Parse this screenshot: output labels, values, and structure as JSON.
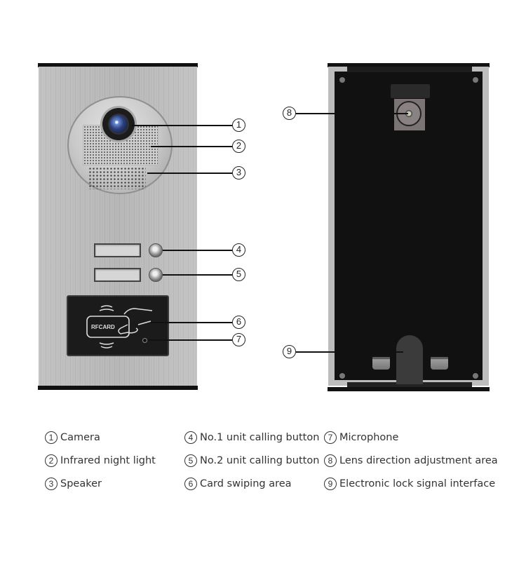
{
  "front_panel": {
    "card_reader_label": "RFCARD"
  },
  "callouts": [
    {
      "id": "1",
      "glyph": "1"
    },
    {
      "id": "2",
      "glyph": "2"
    },
    {
      "id": "3",
      "glyph": "3"
    },
    {
      "id": "4",
      "glyph": "4"
    },
    {
      "id": "5",
      "glyph": "5"
    },
    {
      "id": "6",
      "glyph": "6"
    },
    {
      "id": "7",
      "glyph": "7"
    },
    {
      "id": "8",
      "glyph": "8"
    },
    {
      "id": "9",
      "glyph": "9"
    }
  ],
  "legend": [
    {
      "num": "1",
      "label": "Camera"
    },
    {
      "num": "2",
      "label": "Infrared night light"
    },
    {
      "num": "3",
      "label": "Speaker"
    },
    {
      "num": "4",
      "label": "No.1 unit calling button"
    },
    {
      "num": "5",
      "label": "No.2 unit calling button"
    },
    {
      "num": "6",
      "label": "Card swiping area"
    },
    {
      "num": "7",
      "label": "Microphone"
    },
    {
      "num": "8",
      "label": "Lens direction adjustment area"
    },
    {
      "num": "9",
      "label": "Electronic lock signal interface"
    }
  ]
}
